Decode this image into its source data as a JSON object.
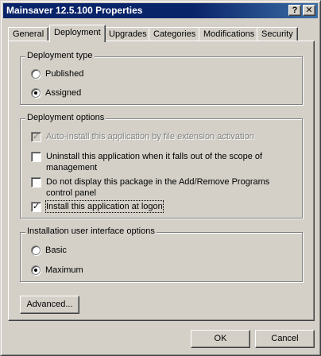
{
  "window": {
    "title": "Mainsaver 12.5.100 Properties",
    "help_glyph": "?",
    "close_glyph": "✕"
  },
  "tabs": [
    {
      "label": "General"
    },
    {
      "label": "Deployment",
      "active": true
    },
    {
      "label": "Upgrades"
    },
    {
      "label": "Categories"
    },
    {
      "label": "Modifications"
    },
    {
      "label": "Security"
    }
  ],
  "deployment_type": {
    "label": "Deployment type",
    "options": [
      {
        "label": "Published",
        "selected": false
      },
      {
        "label": "Assigned",
        "selected": true
      }
    ]
  },
  "deployment_options": {
    "label": "Deployment options",
    "items": [
      {
        "label": "Auto-install this application by file extension activation",
        "checked": true,
        "disabled": true
      },
      {
        "label": "Uninstall this application when it falls out of the scope of management",
        "checked": false,
        "disabled": false
      },
      {
        "label": "Do not display this package in the Add/Remove Programs control panel",
        "checked": false,
        "disabled": false
      },
      {
        "label": "Install this application at logon",
        "checked": true,
        "disabled": false,
        "focused": true
      }
    ]
  },
  "installation_ui": {
    "label": "Installation user interface options",
    "options": [
      {
        "label": "Basic",
        "selected": false
      },
      {
        "label": "Maximum",
        "selected": true
      }
    ]
  },
  "buttons": {
    "advanced": "Advanced...",
    "ok": "OK",
    "cancel": "Cancel"
  },
  "check_glyph": "✓"
}
